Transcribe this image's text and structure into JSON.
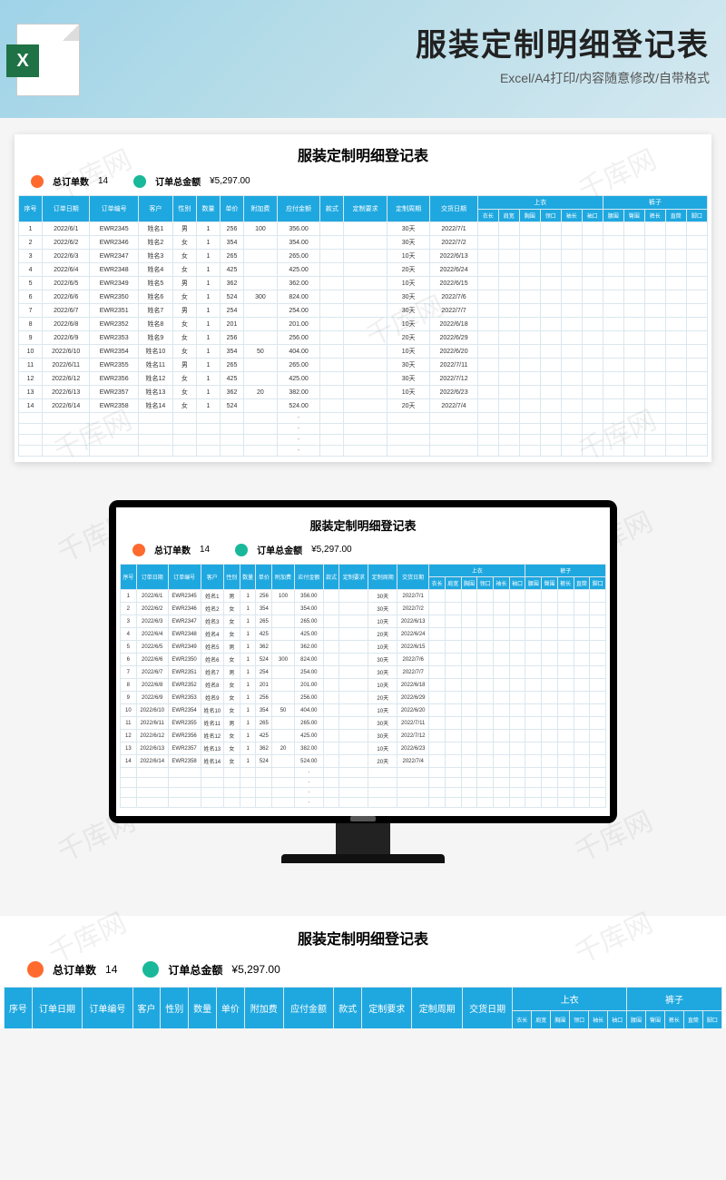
{
  "hero": {
    "title": "服装定制明细登记表",
    "subtitle": "Excel/A4打印/内容随意修改/自带格式",
    "icon_letter": "X"
  },
  "watermark": "千库网",
  "sheet": {
    "title": "服装定制明细登记表",
    "summary": {
      "orders_label": "总订单数",
      "orders_value": "14",
      "amount_label": "订单总金额",
      "amount_value": "¥5,297.00"
    },
    "head_main": [
      "序号",
      "订单日期",
      "订单编号",
      "客户",
      "性别",
      "数量",
      "单价",
      "附加费",
      "应付金额",
      "款式",
      "定制要求",
      "定制周期",
      "交货日期"
    ],
    "head_group_top": "上衣",
    "head_group_pants": "裤子",
    "head_sub_top": [
      "衣长",
      "肩宽",
      "胸围",
      "领口",
      "袖长",
      "袖口"
    ],
    "head_sub_pants": [
      "腰围",
      "臀围",
      "裤长",
      "直筒",
      "脚口"
    ],
    "rows": [
      {
        "n": "1",
        "d": "2022/6/1",
        "o": "EWR2345",
        "c": "姓名1",
        "g": "男",
        "q": "1",
        "p": "256",
        "f": "100",
        "a": "356.00",
        "cy": "30天",
        "dd": "2022/7/1"
      },
      {
        "n": "2",
        "d": "2022/6/2",
        "o": "EWR2346",
        "c": "姓名2",
        "g": "女",
        "q": "1",
        "p": "354",
        "f": "",
        "a": "354.00",
        "cy": "30天",
        "dd": "2022/7/2"
      },
      {
        "n": "3",
        "d": "2022/6/3",
        "o": "EWR2347",
        "c": "姓名3",
        "g": "女",
        "q": "1",
        "p": "265",
        "f": "",
        "a": "265.00",
        "cy": "10天",
        "dd": "2022/6/13"
      },
      {
        "n": "4",
        "d": "2022/6/4",
        "o": "EWR2348",
        "c": "姓名4",
        "g": "女",
        "q": "1",
        "p": "425",
        "f": "",
        "a": "425.00",
        "cy": "20天",
        "dd": "2022/6/24"
      },
      {
        "n": "5",
        "d": "2022/6/5",
        "o": "EWR2349",
        "c": "姓名5",
        "g": "男",
        "q": "1",
        "p": "362",
        "f": "",
        "a": "362.00",
        "cy": "10天",
        "dd": "2022/6/15"
      },
      {
        "n": "6",
        "d": "2022/6/6",
        "o": "EWR2350",
        "c": "姓名6",
        "g": "女",
        "q": "1",
        "p": "524",
        "f": "300",
        "a": "824.00",
        "cy": "30天",
        "dd": "2022/7/6"
      },
      {
        "n": "7",
        "d": "2022/6/7",
        "o": "EWR2351",
        "c": "姓名7",
        "g": "男",
        "q": "1",
        "p": "254",
        "f": "",
        "a": "254.00",
        "cy": "30天",
        "dd": "2022/7/7"
      },
      {
        "n": "8",
        "d": "2022/6/8",
        "o": "EWR2352",
        "c": "姓名8",
        "g": "女",
        "q": "1",
        "p": "201",
        "f": "",
        "a": "201.00",
        "cy": "10天",
        "dd": "2022/6/18"
      },
      {
        "n": "9",
        "d": "2022/6/9",
        "o": "EWR2353",
        "c": "姓名9",
        "g": "女",
        "q": "1",
        "p": "256",
        "f": "",
        "a": "256.00",
        "cy": "20天",
        "dd": "2022/6/29"
      },
      {
        "n": "10",
        "d": "2022/6/10",
        "o": "EWR2354",
        "c": "姓名10",
        "g": "女",
        "q": "1",
        "p": "354",
        "f": "50",
        "a": "404.00",
        "cy": "10天",
        "dd": "2022/6/20"
      },
      {
        "n": "11",
        "d": "2022/6/11",
        "o": "EWR2355",
        "c": "姓名11",
        "g": "男",
        "q": "1",
        "p": "265",
        "f": "",
        "a": "265.00",
        "cy": "30天",
        "dd": "2022/7/11"
      },
      {
        "n": "12",
        "d": "2022/6/12",
        "o": "EWR2356",
        "c": "姓名12",
        "g": "女",
        "q": "1",
        "p": "425",
        "f": "",
        "a": "425.00",
        "cy": "30天",
        "dd": "2022/7/12"
      },
      {
        "n": "13",
        "d": "2022/6/13",
        "o": "EWR2357",
        "c": "姓名13",
        "g": "女",
        "q": "1",
        "p": "362",
        "f": "20",
        "a": "382.00",
        "cy": "10天",
        "dd": "2022/6/23"
      },
      {
        "n": "14",
        "d": "2022/6/14",
        "o": "EWR2358",
        "c": "姓名14",
        "g": "女",
        "q": "1",
        "p": "524",
        "f": "",
        "a": "524.00",
        "cy": "20天",
        "dd": "2022/7/4"
      }
    ],
    "empty_marker": "-"
  }
}
